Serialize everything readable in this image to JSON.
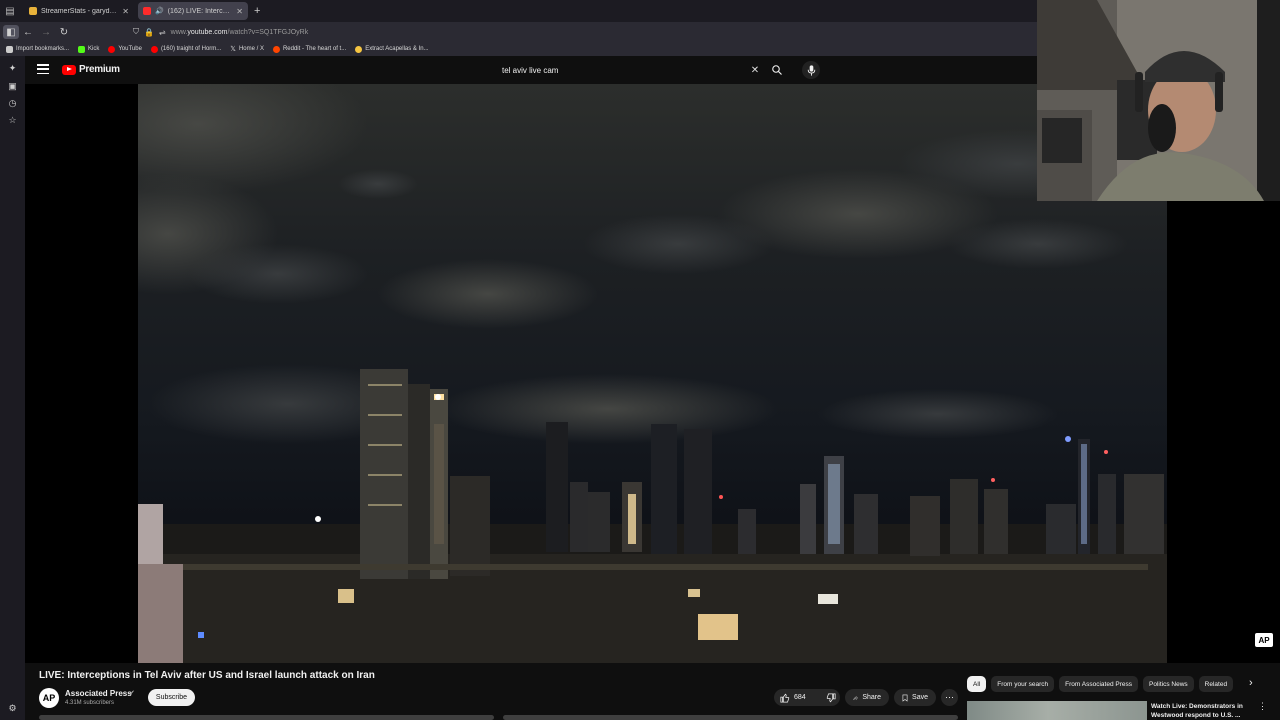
{
  "browser": {
    "tabs": [
      {
        "title": "StreamerStats - garydavid Strea",
        "favicon_color": "#e8b23a",
        "active": false
      },
      {
        "title": "(162) LIVE: Interceptions in",
        "favicon_color": "#ff2b2b",
        "active": true
      }
    ],
    "url_prefix": "www.",
    "url_domain": "youtube.com",
    "url_rest": "/watch?v=SQ1TFGJOyRk",
    "bookmarks": [
      {
        "label": "Import bookmarks...",
        "color": "#cccccc"
      },
      {
        "label": "Kick",
        "color": "#53fc18"
      },
      {
        "label": "YouTube",
        "color": "#ff0000"
      },
      {
        "label": "(160) traight of Horm...",
        "color": "#ff0000"
      },
      {
        "label": "Home / X",
        "color": "#e6e6e6"
      },
      {
        "label": "Reddit - The heart of t...",
        "color": "#ff4500"
      },
      {
        "label": "Extract Acapellas & In...",
        "color": "#f5c542"
      }
    ]
  },
  "youtube": {
    "logo_text": "Premium",
    "search_value": "tel aviv live cam",
    "watermark": "AP"
  },
  "video": {
    "title": "LIVE: Interceptions in Tel Aviv after US and Israel launch attack on Iran",
    "channel": "Associated Press",
    "channel_avatar": "AP",
    "subscribers": "4.31M subscribers",
    "subscribe_label": "Subscribe",
    "likes": "684",
    "share_label": "Share",
    "save_label": "Save"
  },
  "sidebar_chips": [
    "All",
    "From your search",
    "From Associated Press",
    "Politics News",
    "Related"
  ],
  "recommendation": {
    "title": "Watch Live: Demonstrators in Westwood respond to U.S. ..."
  }
}
